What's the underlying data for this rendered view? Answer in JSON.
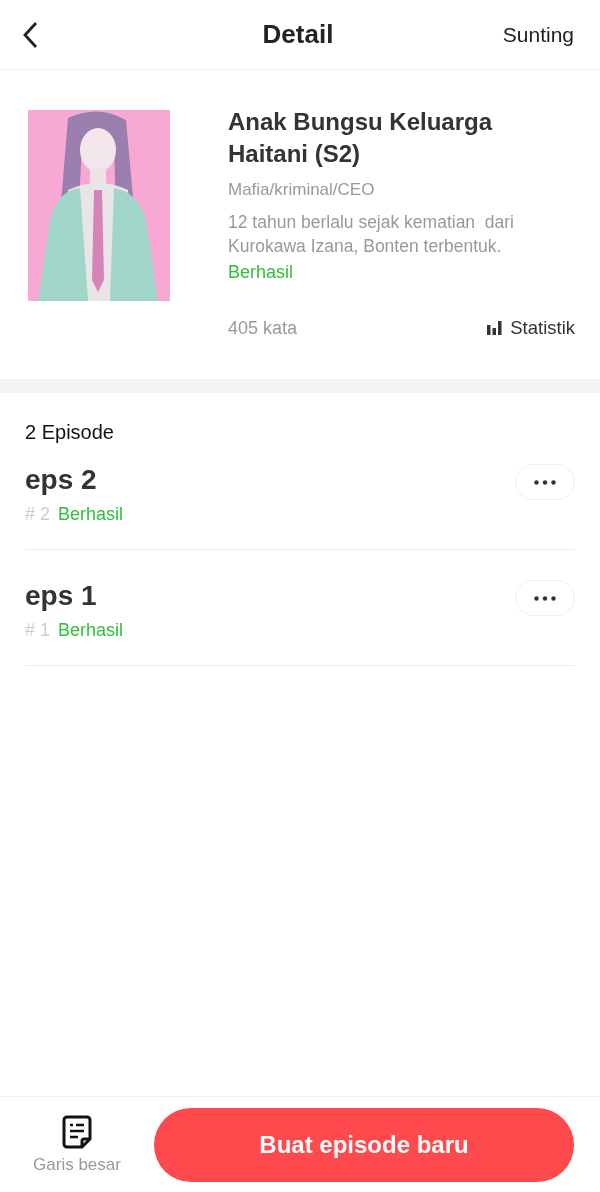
{
  "header": {
    "title": "Detail",
    "action": "Sunting"
  },
  "book": {
    "title": "Anak Bungsu Keluarga Haitani (S2)",
    "genre": "Mafia/kriminal/CEO",
    "synopsis": "12 tahun berlalu sejak kematian  dari Kurokawa Izana, Bonten terbentuk.",
    "status": "Berhasil",
    "word_count": "405 kata",
    "stats_link": "Statistik"
  },
  "episodes": {
    "count_label": "2 Episode",
    "items": [
      {
        "title": "eps 2",
        "number": "# 2",
        "status": "Berhasil"
      },
      {
        "title": "eps 1",
        "number": "# 1",
        "status": "Berhasil"
      }
    ]
  },
  "bottom_bar": {
    "outline": "Garis besar",
    "primary_button": "Buat episode baru"
  }
}
